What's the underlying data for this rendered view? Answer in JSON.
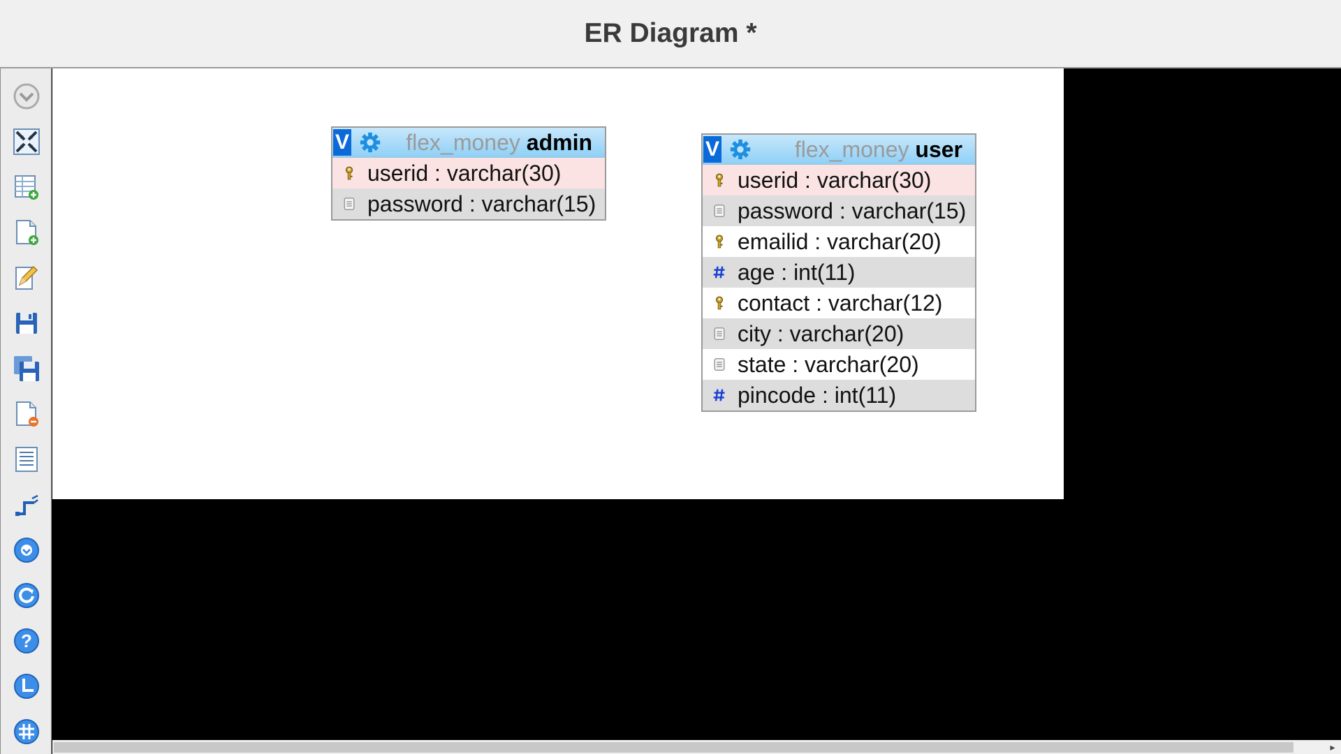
{
  "window": {
    "title": "ER Diagram *"
  },
  "toolbar": {
    "items": [
      {
        "name": "toggle-menu",
        "icon": "chevron-down-circle-icon"
      },
      {
        "name": "angular-links",
        "icon": "move-arrows-icon"
      },
      {
        "name": "add-tables",
        "icon": "table-add-icon"
      },
      {
        "name": "new-page",
        "icon": "page-add-icon"
      },
      {
        "name": "edit-page",
        "icon": "pencil-edit-icon"
      },
      {
        "name": "save-page",
        "icon": "floppy-save-icon"
      },
      {
        "name": "save-page-as",
        "icon": "floppy-save-as-icon"
      },
      {
        "name": "delete-page",
        "icon": "page-delete-icon"
      },
      {
        "name": "view-list",
        "icon": "list-icon"
      },
      {
        "name": "relation",
        "icon": "relation-line-icon"
      },
      {
        "name": "toggle-all",
        "icon": "circle-down-icon"
      },
      {
        "name": "refresh",
        "icon": "refresh-icon"
      },
      {
        "name": "help",
        "icon": "help-icon"
      },
      {
        "name": "snap-to-grid",
        "icon": "align-icon"
      },
      {
        "name": "grid",
        "icon": "grid-icon"
      }
    ]
  },
  "tables": [
    {
      "db": "flex_money",
      "name": "admin",
      "toggle_label": "V",
      "columns": [
        {
          "text": "userid : varchar(30)",
          "type": "key",
          "style": "pk"
        },
        {
          "text": "password : varchar(15)",
          "type": "text",
          "style": "alt"
        }
      ]
    },
    {
      "db": "flex_money",
      "name": "user",
      "toggle_label": "V",
      "columns": [
        {
          "text": "userid : varchar(30)",
          "type": "key",
          "style": "pk"
        },
        {
          "text": "password : varchar(15)",
          "type": "text",
          "style": "alt"
        },
        {
          "text": "emailid : varchar(20)",
          "type": "key",
          "style": "plain"
        },
        {
          "text": "age : int(11)",
          "type": "number",
          "style": "alt"
        },
        {
          "text": "contact : varchar(12)",
          "type": "key",
          "style": "plain"
        },
        {
          "text": "city : varchar(20)",
          "type": "text",
          "style": "alt"
        },
        {
          "text": "state : varchar(20)",
          "type": "text",
          "style": "plain"
        },
        {
          "text": "pincode : int(11)",
          "type": "number",
          "style": "alt"
        }
      ]
    }
  ],
  "colors": {
    "header_accent": "#0b6ad8",
    "pk_row": "#fbe3e3",
    "alt_row": "#dddddd",
    "number_icon": "#1a3fd6"
  }
}
